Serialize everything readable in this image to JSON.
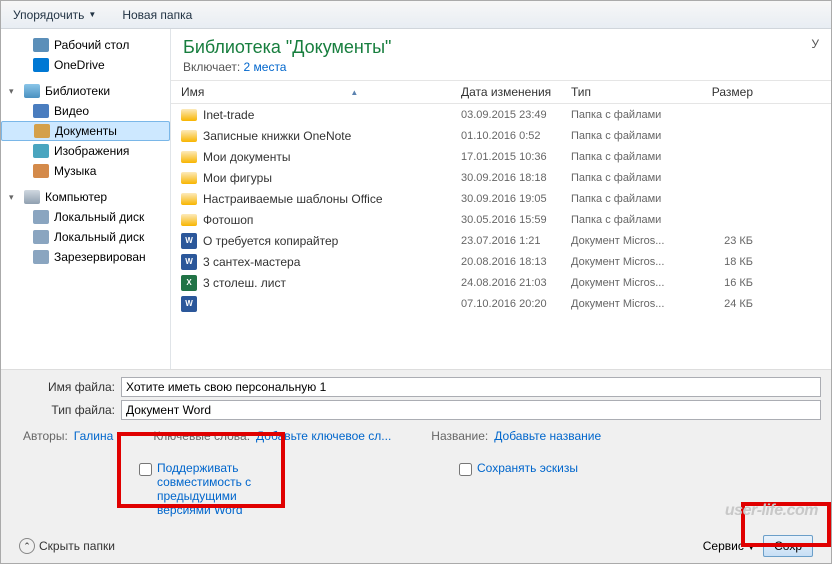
{
  "toolbar": {
    "organize": "Упорядочить",
    "newFolder": "Новая папка"
  },
  "sidebar": {
    "items": [
      {
        "label": "Рабочий стол",
        "ico": "#5b8fb9"
      },
      {
        "label": "OneDrive",
        "ico": "#0078d4"
      }
    ],
    "libs": {
      "root": "Библиотеки",
      "items": [
        {
          "label": "Видео",
          "ico": "#4a7dbf"
        },
        {
          "label": "Документы",
          "ico": "#d4a04a",
          "selected": true
        },
        {
          "label": "Изображения",
          "ico": "#4aa5bf"
        },
        {
          "label": "Музыка",
          "ico": "#d48a4a"
        }
      ]
    },
    "comp": {
      "root": "Компьютер",
      "items": [
        {
          "label": "Локальный диск",
          "ico": "#8aa5c0"
        },
        {
          "label": "Локальный диск",
          "ico": "#8aa5c0"
        },
        {
          "label": "Зарезервирован",
          "ico": "#8aa5c0"
        }
      ]
    }
  },
  "header": {
    "title": "Библиотека \"Документы\"",
    "includesLabel": "Включает:",
    "includesLink": "2 места",
    "arrangeLabel": "У"
  },
  "columns": {
    "name": "Имя",
    "date": "Дата изменения",
    "type": "Тип",
    "size": "Размер"
  },
  "files": [
    {
      "icon": "folder",
      "name": "Inet-trade",
      "date": "03.09.2015 23:49",
      "type": "Папка с файлами",
      "size": ""
    },
    {
      "icon": "folder",
      "name": "Записные книжки OneNote",
      "date": "01.10.2016 0:52",
      "type": "Папка с файлами",
      "size": ""
    },
    {
      "icon": "folder",
      "name": "Мои документы",
      "date": "17.01.2015 10:36",
      "type": "Папка с файлами",
      "size": ""
    },
    {
      "icon": "folder",
      "name": "Мои фигуры",
      "date": "30.09.2016 18:18",
      "type": "Папка с файлами",
      "size": ""
    },
    {
      "icon": "folder",
      "name": "Настраиваемые шаблоны Office",
      "date": "30.09.2016 19:05",
      "type": "Папка с файлами",
      "size": ""
    },
    {
      "icon": "folder",
      "name": "Фотошоп",
      "date": "30.05.2016 15:59",
      "type": "Папка с файлами",
      "size": ""
    },
    {
      "icon": "word",
      "name": "О требуется копирайтер",
      "date": "23.07.2016 1:21",
      "type": "Документ Micros...",
      "size": "23 КБ"
    },
    {
      "icon": "word",
      "name": "3 сантех-мастера",
      "date": "20.08.2016 18:13",
      "type": "Документ Micros...",
      "size": "18 КБ"
    },
    {
      "icon": "excel",
      "name": "3 столеш. лист",
      "date": "24.08.2016 21:03",
      "type": "Документ Micros...",
      "size": "16 КБ"
    },
    {
      "icon": "word",
      "name": "",
      "date": "07.10.2016 20:20",
      "type": "Документ Micros...",
      "size": "24 КБ"
    }
  ],
  "fields": {
    "filenameLabel": "Имя файла:",
    "filenameValue": "Хотите иметь свою персональную 1",
    "filetypeLabel": "Тип файла:",
    "filetypeValue": "Документ Word"
  },
  "meta": {
    "authorsLabel": "Авторы:",
    "authorsValue": "Галина",
    "tagsLabel": "Ключевые слова:",
    "tagsValue": "Добавьте ключевое сл...",
    "titleLabel": "Название:",
    "titleValue": "Добавьте название"
  },
  "checks": {
    "compat": "Поддерживать совместимость с предыдущими версиями Word",
    "thumbs": "Сохранять эскизы"
  },
  "footer": {
    "hideFolders": "Скрыть папки",
    "tools": "Сервис",
    "save": "Сохр"
  },
  "watermark": "user-life.com"
}
